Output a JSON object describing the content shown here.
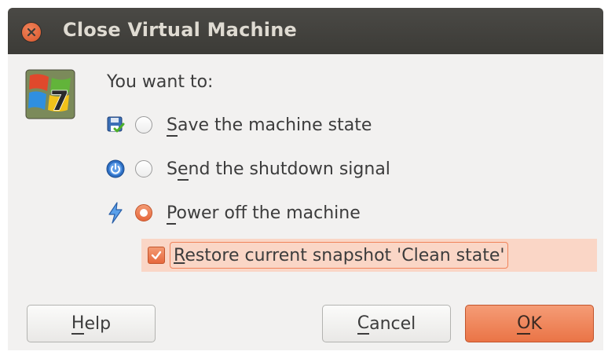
{
  "window": {
    "title": "Close Virtual Machine"
  },
  "prompt": "You want to:",
  "options": [
    {
      "key": "S",
      "rest": "ave the machine state",
      "icon": "save-state-icon",
      "checked": false
    },
    {
      "pre": "S",
      "key": "e",
      "rest": "nd the shutdown signal",
      "icon": "power-button-icon",
      "checked": false
    },
    {
      "key": "P",
      "rest": "ower off the machine",
      "icon": "lightning-icon",
      "checked": true
    }
  ],
  "restore": {
    "key": "R",
    "rest": "estore current snapshot 'Clean state'",
    "checked": true
  },
  "buttons": {
    "help": {
      "key": "H",
      "rest": "elp"
    },
    "cancel": {
      "key": "C",
      "rest": "ancel"
    },
    "ok": {
      "key": "O",
      "rest": "K"
    }
  },
  "colors": {
    "accent": "#e6683d",
    "titlebar": "#3c3b37",
    "highlight": "#fad6c6"
  }
}
